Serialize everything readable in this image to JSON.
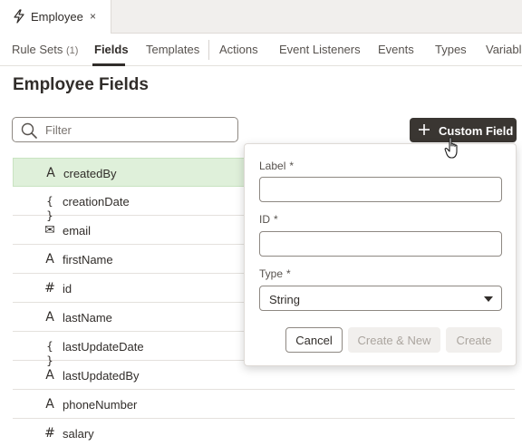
{
  "doc_tab": {
    "label": "Employee",
    "close": "×"
  },
  "sub_tabs": [
    {
      "label": "Rule Sets",
      "count": "(1)"
    },
    {
      "label": "Fields"
    },
    {
      "label": "Templates"
    },
    {
      "label": "Actions"
    },
    {
      "label": "Event Listeners"
    },
    {
      "label": "Events"
    },
    {
      "label": "Types"
    },
    {
      "label": "Variable"
    }
  ],
  "page_title": "Employee Fields",
  "filter": {
    "placeholder": "Filter",
    "value": ""
  },
  "custom_field_button": {
    "label": "Custom Field"
  },
  "fields": [
    {
      "icon": "string-icon",
      "glyph": "A",
      "name": "createdBy"
    },
    {
      "icon": "object-icon",
      "glyph": "{ }",
      "name": "creationDate"
    },
    {
      "icon": "email-icon",
      "glyph": "✉",
      "name": "email"
    },
    {
      "icon": "string-icon",
      "glyph": "A",
      "name": "firstName"
    },
    {
      "icon": "number-icon",
      "glyph": "#",
      "name": "id"
    },
    {
      "icon": "string-icon",
      "glyph": "A",
      "name": "lastName"
    },
    {
      "icon": "object-icon",
      "glyph": "{ }",
      "name": "lastUpdateDate"
    },
    {
      "icon": "string-icon",
      "glyph": "A",
      "name": "lastUpdatedBy"
    },
    {
      "icon": "string-icon",
      "glyph": "A",
      "name": "phoneNumber"
    },
    {
      "icon": "number-icon",
      "glyph": "#",
      "name": "salary"
    }
  ],
  "popup": {
    "label_field": {
      "label": "Label",
      "required": "*",
      "value": ""
    },
    "id_field": {
      "label": "ID",
      "required": "*",
      "value": ""
    },
    "type_field": {
      "label": "Type",
      "required": "*",
      "value": "String"
    },
    "cancel": "Cancel",
    "create_new": "Create & New",
    "create": "Create"
  },
  "colors": {
    "selected_row": "#dff0da",
    "button_dark": "#3a3632"
  }
}
